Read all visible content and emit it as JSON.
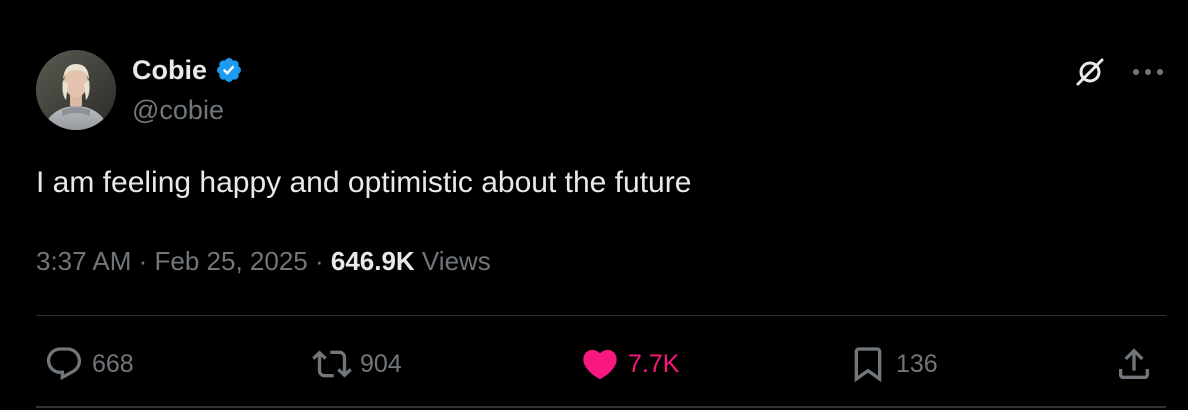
{
  "author": {
    "display_name": "Cobie",
    "handle": "@cobie",
    "verified": true,
    "verified_color": "#1d9bf0"
  },
  "tweet": {
    "text": "I am feeling happy and optimistic about the future"
  },
  "meta": {
    "time": "3:37 AM",
    "separator": " · ",
    "date": "Feb 25, 2025",
    "views_count": "646.9K",
    "views_label": " Views"
  },
  "actions": {
    "replies": "668",
    "reposts": "904",
    "likes": "7.7K",
    "bookmarks": "136"
  },
  "icons": {
    "grok": "grok-icon",
    "more": "more-icon",
    "reply": "reply-icon",
    "repost": "repost-icon",
    "like": "heart-icon",
    "bookmark": "bookmark-icon",
    "share": "share-icon"
  },
  "colors": {
    "background": "#000000",
    "text_primary": "#e7e9ea",
    "text_secondary": "#71767b",
    "like_active": "#f91880",
    "divider": "#2f3336"
  }
}
